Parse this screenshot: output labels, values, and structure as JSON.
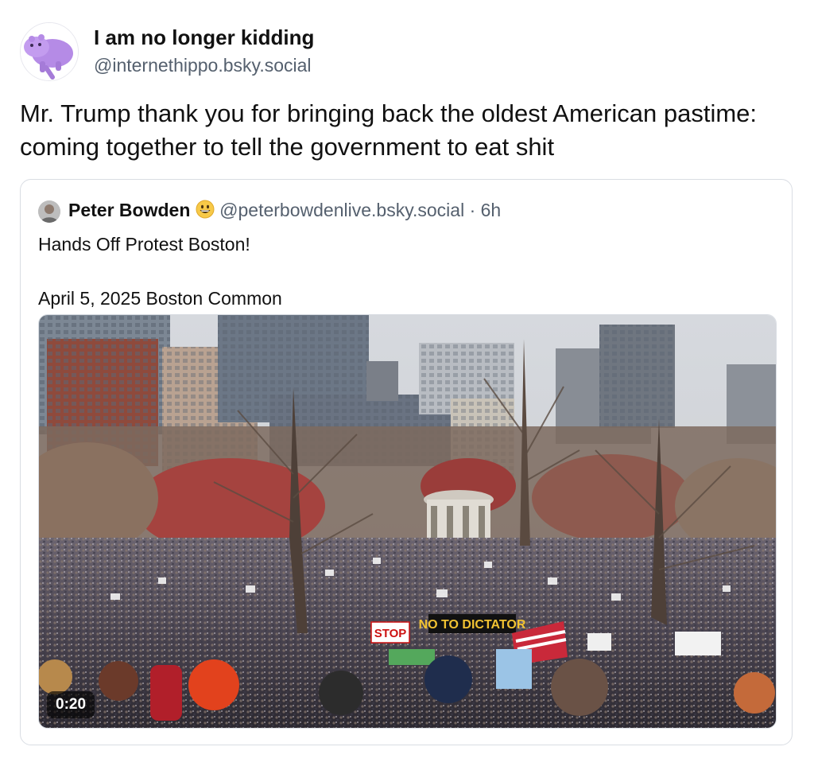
{
  "post": {
    "author": {
      "display_name": "I am no longer kidding",
      "handle": "@internethippo.bsky.social",
      "avatar_icon": "purple-hippo-avatar"
    },
    "text": "Mr. Trump thank you for bringing back the oldest American pastime: coming together to tell the government to eat shit"
  },
  "quote": {
    "author": {
      "display_name": "Peter Bowden",
      "emoji_icon": "grinning-face-emoji",
      "handle": "@peterbowdenlive.bsky.social",
      "separator": " · ",
      "time": "6h"
    },
    "text_line1": "Hands Off Protest Boston!",
    "text_line2": "April 5, 2025 Boston Common",
    "video": {
      "duration": "0:20",
      "signs": {
        "stop": "STOP",
        "banner": "NO TO DICTATOR"
      }
    }
  },
  "colors": {
    "name": "#111111",
    "handle": "#55606e",
    "border": "#d9dde3",
    "hippo": "#b58be6"
  }
}
